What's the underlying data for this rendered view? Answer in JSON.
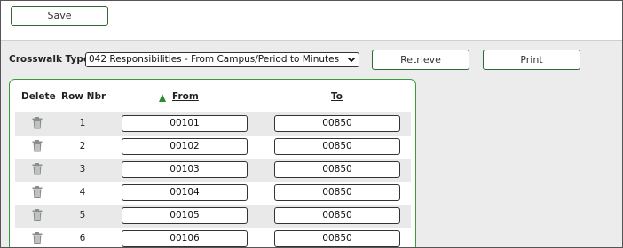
{
  "toolbar": {
    "save_label": "Save"
  },
  "crosswalk": {
    "label": "Crosswalk Type:",
    "selected": "042 Responsibilities - From Campus/Period to Minutes",
    "retrieve_label": "Retrieve",
    "print_label": "Print"
  },
  "grid": {
    "columns": {
      "delete": "Delete",
      "row_nbr": "Row Nbr",
      "from": "From",
      "to": "To"
    },
    "sorted_by": "From",
    "rows": [
      {
        "row_nbr": "1",
        "from": "00101",
        "to": "00850"
      },
      {
        "row_nbr": "2",
        "from": "00102",
        "to": "00850"
      },
      {
        "row_nbr": "3",
        "from": "00103",
        "to": "00850"
      },
      {
        "row_nbr": "4",
        "from": "00104",
        "to": "00850"
      },
      {
        "row_nbr": "5",
        "from": "00105",
        "to": "00850"
      },
      {
        "row_nbr": "6",
        "from": "00106",
        "to": "00850"
      }
    ]
  },
  "colors": {
    "accent_green": "#3a9b3a",
    "trash_gray": "#8a8f8a"
  },
  "icons": {
    "delete": "trash-icon",
    "sort": "sort-ascending-icon",
    "dropdown": "chevron-down-icon"
  }
}
